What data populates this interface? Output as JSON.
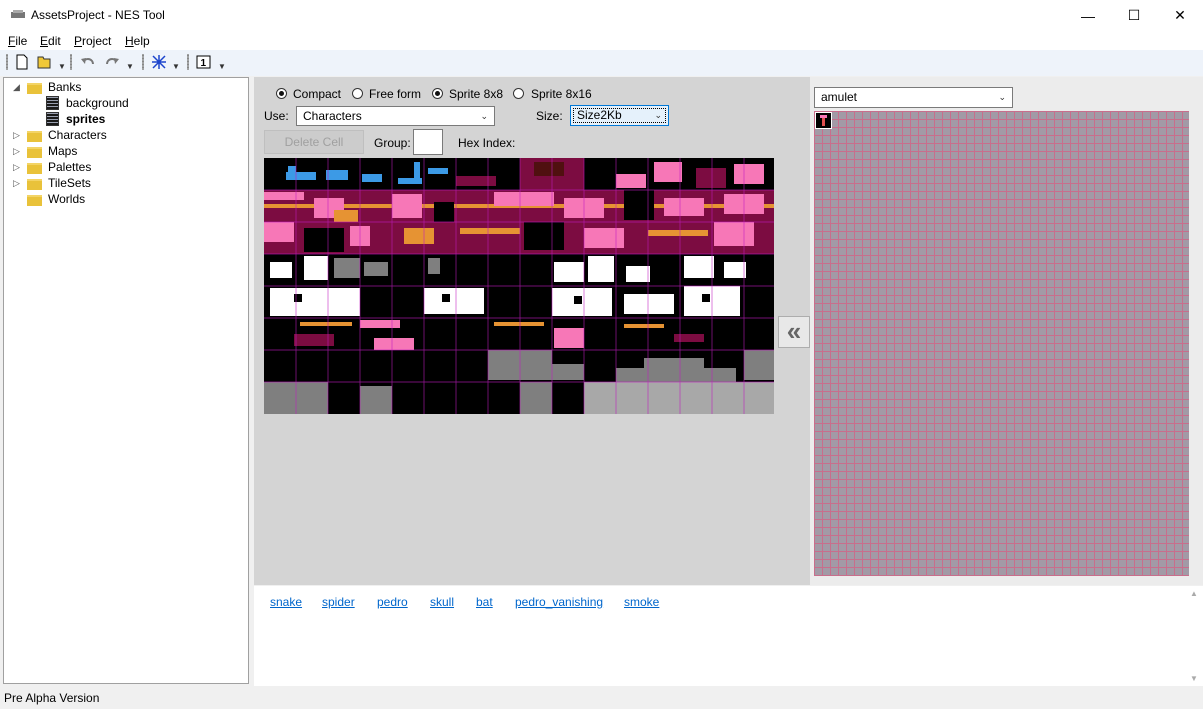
{
  "window": {
    "title": "AssetsProject - NES Tool"
  },
  "menu": [
    {
      "label": "File",
      "accel": "F",
      "rest": "ile"
    },
    {
      "label": "Edit",
      "accel": "E",
      "rest": "dit"
    },
    {
      "label": "Project",
      "accel": "P",
      "rest": "roject"
    },
    {
      "label": "Help",
      "accel": "H",
      "rest": "elp"
    }
  ],
  "tree": {
    "root": "Banks",
    "banks": [
      "background",
      "sprites"
    ],
    "folders": [
      "Characters",
      "Maps",
      "Palettes",
      "TileSets",
      "Worlds"
    ]
  },
  "mode": {
    "options": [
      "Compact",
      "Free form",
      "Sprite 8x8",
      "Sprite 8x16"
    ],
    "selected_compact": true,
    "selected_sprite": "Sprite 8x8"
  },
  "use": {
    "label": "Use:",
    "value": "Characters"
  },
  "size": {
    "label": "Size:",
    "value": "Size2Kb"
  },
  "delete_cell": "Delete Cell",
  "group_label": "Group:",
  "hex_index_label": "Hex Index:",
  "right": {
    "selected_character": "amulet"
  },
  "links": [
    "snake",
    "spider",
    "pedro",
    "skull",
    "bat",
    "pedro_vanishing",
    "smoke"
  ],
  "status": "Pre Alpha Version",
  "colors": {
    "accent": "#0078d7",
    "grid_magenta": "#c01cc0",
    "pink": "#f777b7",
    "maroon": "#7c0c41",
    "orange": "#e69333",
    "blue": "#3c9ae6",
    "gray": "#7f7f7f"
  }
}
